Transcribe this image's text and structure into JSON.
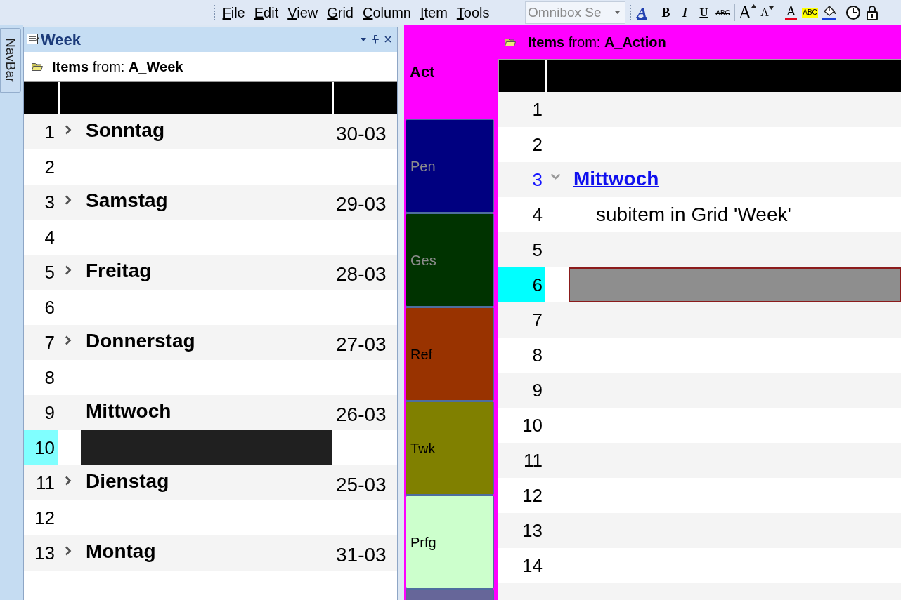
{
  "menu": [
    "File",
    "Edit",
    "View",
    "Grid",
    "Column",
    "Item",
    "Tools"
  ],
  "omnibox": {
    "placeholder": "Omnibox Se"
  },
  "toolbar": [
    [
      {
        "kind": "style",
        "label": "A"
      }
    ],
    [
      {
        "kind": "bold",
        "label": "B"
      },
      {
        "kind": "italic",
        "label": "I"
      },
      {
        "kind": "underline",
        "label": "U"
      },
      {
        "kind": "strike",
        "label": "ABC"
      }
    ],
    [
      {
        "kind": "grow",
        "label": "A"
      },
      {
        "kind": "shrink",
        "label": "A"
      }
    ],
    [
      {
        "kind": "fontcolor",
        "label": "A"
      },
      {
        "kind": "highlight",
        "label": "ABC"
      },
      {
        "kind": "fill"
      }
    ],
    [
      {
        "kind": "clock"
      },
      {
        "kind": "lock"
      }
    ]
  ],
  "navbar": {
    "label": "NavBar"
  },
  "week_pane": {
    "title": "Week",
    "active": true,
    "source": "**Items** from: **A_Week**",
    "rows": [
      {
        "number": "1",
        "name": "Sonntag",
        "date": "30-03",
        "expanded": false,
        "selected": false
      },
      {
        "number": "2",
        "selected": false
      },
      {
        "number": "3",
        "name": "Samstag",
        "date": "29-03",
        "expanded": false,
        "selected": false
      },
      {
        "number": "4",
        "selected": false
      },
      {
        "number": "5",
        "name": "Freitag",
        "date": "28-03",
        "expanded": false,
        "selected": false
      },
      {
        "number": "6",
        "selected": false
      },
      {
        "number": "7",
        "name": "Donnerstag",
        "date": "27-03",
        "expanded": false,
        "selected": false
      },
      {
        "number": "8",
        "selected": false
      },
      {
        "number": "9",
        "name": "Mittwoch",
        "date": "26-03",
        "selected": false
      },
      {
        "number": "10",
        "selected": true
      },
      {
        "number": "11",
        "name": "Dienstag",
        "date": "25-03",
        "expanded": false,
        "selected": false
      },
      {
        "number": "12",
        "selected": false
      },
      {
        "number": "13",
        "name": "Montag",
        "date": "31-03",
        "expanded": false,
        "selected": false
      }
    ]
  },
  "action_pane": {
    "active": false,
    "source": "**Items** from: **A_Action**",
    "categories": [
      {
        "label": "Act",
        "color": "#ff00ff",
        "selected": true
      },
      {
        "label": "Pen",
        "color": "#000080",
        "selected": false
      },
      {
        "label": "Ges",
        "color": "#003300",
        "selected": false
      },
      {
        "label": "Ref",
        "color": "#993300",
        "selected": false
      },
      {
        "label": "Twk",
        "color": "#808000",
        "selected": false
      },
      {
        "label": "Prfg",
        "color": "#ccffcc",
        "selected": false
      },
      {
        "color": "#666699",
        "selected": false
      }
    ],
    "rows": [
      {
        "number": "1",
        "link": false,
        "selected": false
      },
      {
        "number": "2",
        "link": false,
        "selected": false
      },
      {
        "number": "3",
        "name": "Mittwoch",
        "link": true,
        "expanded": true,
        "selected": false,
        "children": [
          {
            "number": "4",
            "name": "subitem in Grid 'Week'",
            "link": false,
            "selected": false
          }
        ]
      },
      {
        "number": "5",
        "link": false,
        "selected": false
      },
      {
        "number": "6",
        "link": false,
        "selected": true
      },
      {
        "number": "7",
        "link": false,
        "selected": false
      },
      {
        "number": "8",
        "link": false,
        "selected": false
      },
      {
        "number": "9",
        "link": false,
        "selected": false
      },
      {
        "number": "10",
        "link": false,
        "selected": false
      },
      {
        "number": "11",
        "link": false,
        "selected": false
      },
      {
        "number": "12",
        "link": false,
        "selected": false
      },
      {
        "number": "13",
        "link": false,
        "selected": false
      },
      {
        "number": "14",
        "link": false,
        "selected": false
      }
    ]
  }
}
